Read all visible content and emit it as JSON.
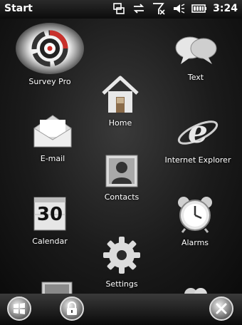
{
  "statusbar": {
    "title": "Start",
    "time": "3:24",
    "icons": [
      "connectivity-icon",
      "sync-icon",
      "signal-off-icon",
      "volume-icon",
      "battery-icon"
    ]
  },
  "apps": {
    "survey_pro": "Survey Pro",
    "text": "Text",
    "home": "Home",
    "email": "E-mail",
    "ie": "Internet Explorer",
    "contacts": "Contacts",
    "calendar": "Calendar",
    "calendar_day": "30",
    "alarms": "Alarms",
    "settings": "Settings"
  },
  "bottombar": {
    "buttons": [
      "windows-start-icon",
      "lock-icon",
      "close-icon"
    ]
  },
  "colors": {
    "background": "#111111",
    "surveypro_red": "#c8302b",
    "ie_blue": "#3b73c7"
  }
}
